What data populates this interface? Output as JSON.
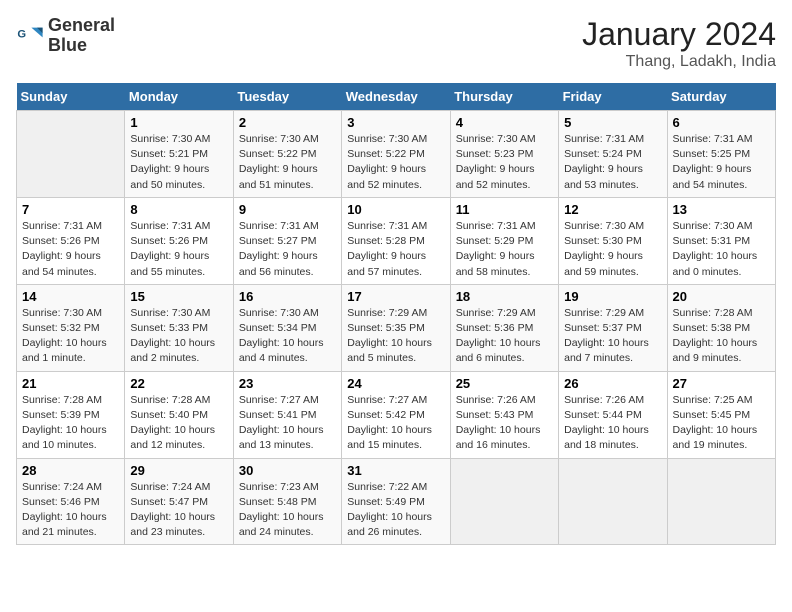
{
  "header": {
    "logo_line1": "General",
    "logo_line2": "Blue",
    "title": "January 2024",
    "subtitle": "Thang, Ladakh, India"
  },
  "days_of_week": [
    "Sunday",
    "Monday",
    "Tuesday",
    "Wednesday",
    "Thursday",
    "Friday",
    "Saturday"
  ],
  "weeks": [
    [
      {
        "num": "",
        "info": ""
      },
      {
        "num": "1",
        "info": "Sunrise: 7:30 AM\nSunset: 5:21 PM\nDaylight: 9 hours\nand 50 minutes."
      },
      {
        "num": "2",
        "info": "Sunrise: 7:30 AM\nSunset: 5:22 PM\nDaylight: 9 hours\nand 51 minutes."
      },
      {
        "num": "3",
        "info": "Sunrise: 7:30 AM\nSunset: 5:22 PM\nDaylight: 9 hours\nand 52 minutes."
      },
      {
        "num": "4",
        "info": "Sunrise: 7:30 AM\nSunset: 5:23 PM\nDaylight: 9 hours\nand 52 minutes."
      },
      {
        "num": "5",
        "info": "Sunrise: 7:31 AM\nSunset: 5:24 PM\nDaylight: 9 hours\nand 53 minutes."
      },
      {
        "num": "6",
        "info": "Sunrise: 7:31 AM\nSunset: 5:25 PM\nDaylight: 9 hours\nand 54 minutes."
      }
    ],
    [
      {
        "num": "7",
        "info": "Sunrise: 7:31 AM\nSunset: 5:26 PM\nDaylight: 9 hours\nand 54 minutes."
      },
      {
        "num": "8",
        "info": "Sunrise: 7:31 AM\nSunset: 5:26 PM\nDaylight: 9 hours\nand 55 minutes."
      },
      {
        "num": "9",
        "info": "Sunrise: 7:31 AM\nSunset: 5:27 PM\nDaylight: 9 hours\nand 56 minutes."
      },
      {
        "num": "10",
        "info": "Sunrise: 7:31 AM\nSunset: 5:28 PM\nDaylight: 9 hours\nand 57 minutes."
      },
      {
        "num": "11",
        "info": "Sunrise: 7:31 AM\nSunset: 5:29 PM\nDaylight: 9 hours\nand 58 minutes."
      },
      {
        "num": "12",
        "info": "Sunrise: 7:30 AM\nSunset: 5:30 PM\nDaylight: 9 hours\nand 59 minutes."
      },
      {
        "num": "13",
        "info": "Sunrise: 7:30 AM\nSunset: 5:31 PM\nDaylight: 10 hours\nand 0 minutes."
      }
    ],
    [
      {
        "num": "14",
        "info": "Sunrise: 7:30 AM\nSunset: 5:32 PM\nDaylight: 10 hours\nand 1 minute."
      },
      {
        "num": "15",
        "info": "Sunrise: 7:30 AM\nSunset: 5:33 PM\nDaylight: 10 hours\nand 2 minutes."
      },
      {
        "num": "16",
        "info": "Sunrise: 7:30 AM\nSunset: 5:34 PM\nDaylight: 10 hours\nand 4 minutes."
      },
      {
        "num": "17",
        "info": "Sunrise: 7:29 AM\nSunset: 5:35 PM\nDaylight: 10 hours\nand 5 minutes."
      },
      {
        "num": "18",
        "info": "Sunrise: 7:29 AM\nSunset: 5:36 PM\nDaylight: 10 hours\nand 6 minutes."
      },
      {
        "num": "19",
        "info": "Sunrise: 7:29 AM\nSunset: 5:37 PM\nDaylight: 10 hours\nand 7 minutes."
      },
      {
        "num": "20",
        "info": "Sunrise: 7:28 AM\nSunset: 5:38 PM\nDaylight: 10 hours\nand 9 minutes."
      }
    ],
    [
      {
        "num": "21",
        "info": "Sunrise: 7:28 AM\nSunset: 5:39 PM\nDaylight: 10 hours\nand 10 minutes."
      },
      {
        "num": "22",
        "info": "Sunrise: 7:28 AM\nSunset: 5:40 PM\nDaylight: 10 hours\nand 12 minutes."
      },
      {
        "num": "23",
        "info": "Sunrise: 7:27 AM\nSunset: 5:41 PM\nDaylight: 10 hours\nand 13 minutes."
      },
      {
        "num": "24",
        "info": "Sunrise: 7:27 AM\nSunset: 5:42 PM\nDaylight: 10 hours\nand 15 minutes."
      },
      {
        "num": "25",
        "info": "Sunrise: 7:26 AM\nSunset: 5:43 PM\nDaylight: 10 hours\nand 16 minutes."
      },
      {
        "num": "26",
        "info": "Sunrise: 7:26 AM\nSunset: 5:44 PM\nDaylight: 10 hours\nand 18 minutes."
      },
      {
        "num": "27",
        "info": "Sunrise: 7:25 AM\nSunset: 5:45 PM\nDaylight: 10 hours\nand 19 minutes."
      }
    ],
    [
      {
        "num": "28",
        "info": "Sunrise: 7:24 AM\nSunset: 5:46 PM\nDaylight: 10 hours\nand 21 minutes."
      },
      {
        "num": "29",
        "info": "Sunrise: 7:24 AM\nSunset: 5:47 PM\nDaylight: 10 hours\nand 23 minutes."
      },
      {
        "num": "30",
        "info": "Sunrise: 7:23 AM\nSunset: 5:48 PM\nDaylight: 10 hours\nand 24 minutes."
      },
      {
        "num": "31",
        "info": "Sunrise: 7:22 AM\nSunset: 5:49 PM\nDaylight: 10 hours\nand 26 minutes."
      },
      {
        "num": "",
        "info": ""
      },
      {
        "num": "",
        "info": ""
      },
      {
        "num": "",
        "info": ""
      }
    ]
  ]
}
